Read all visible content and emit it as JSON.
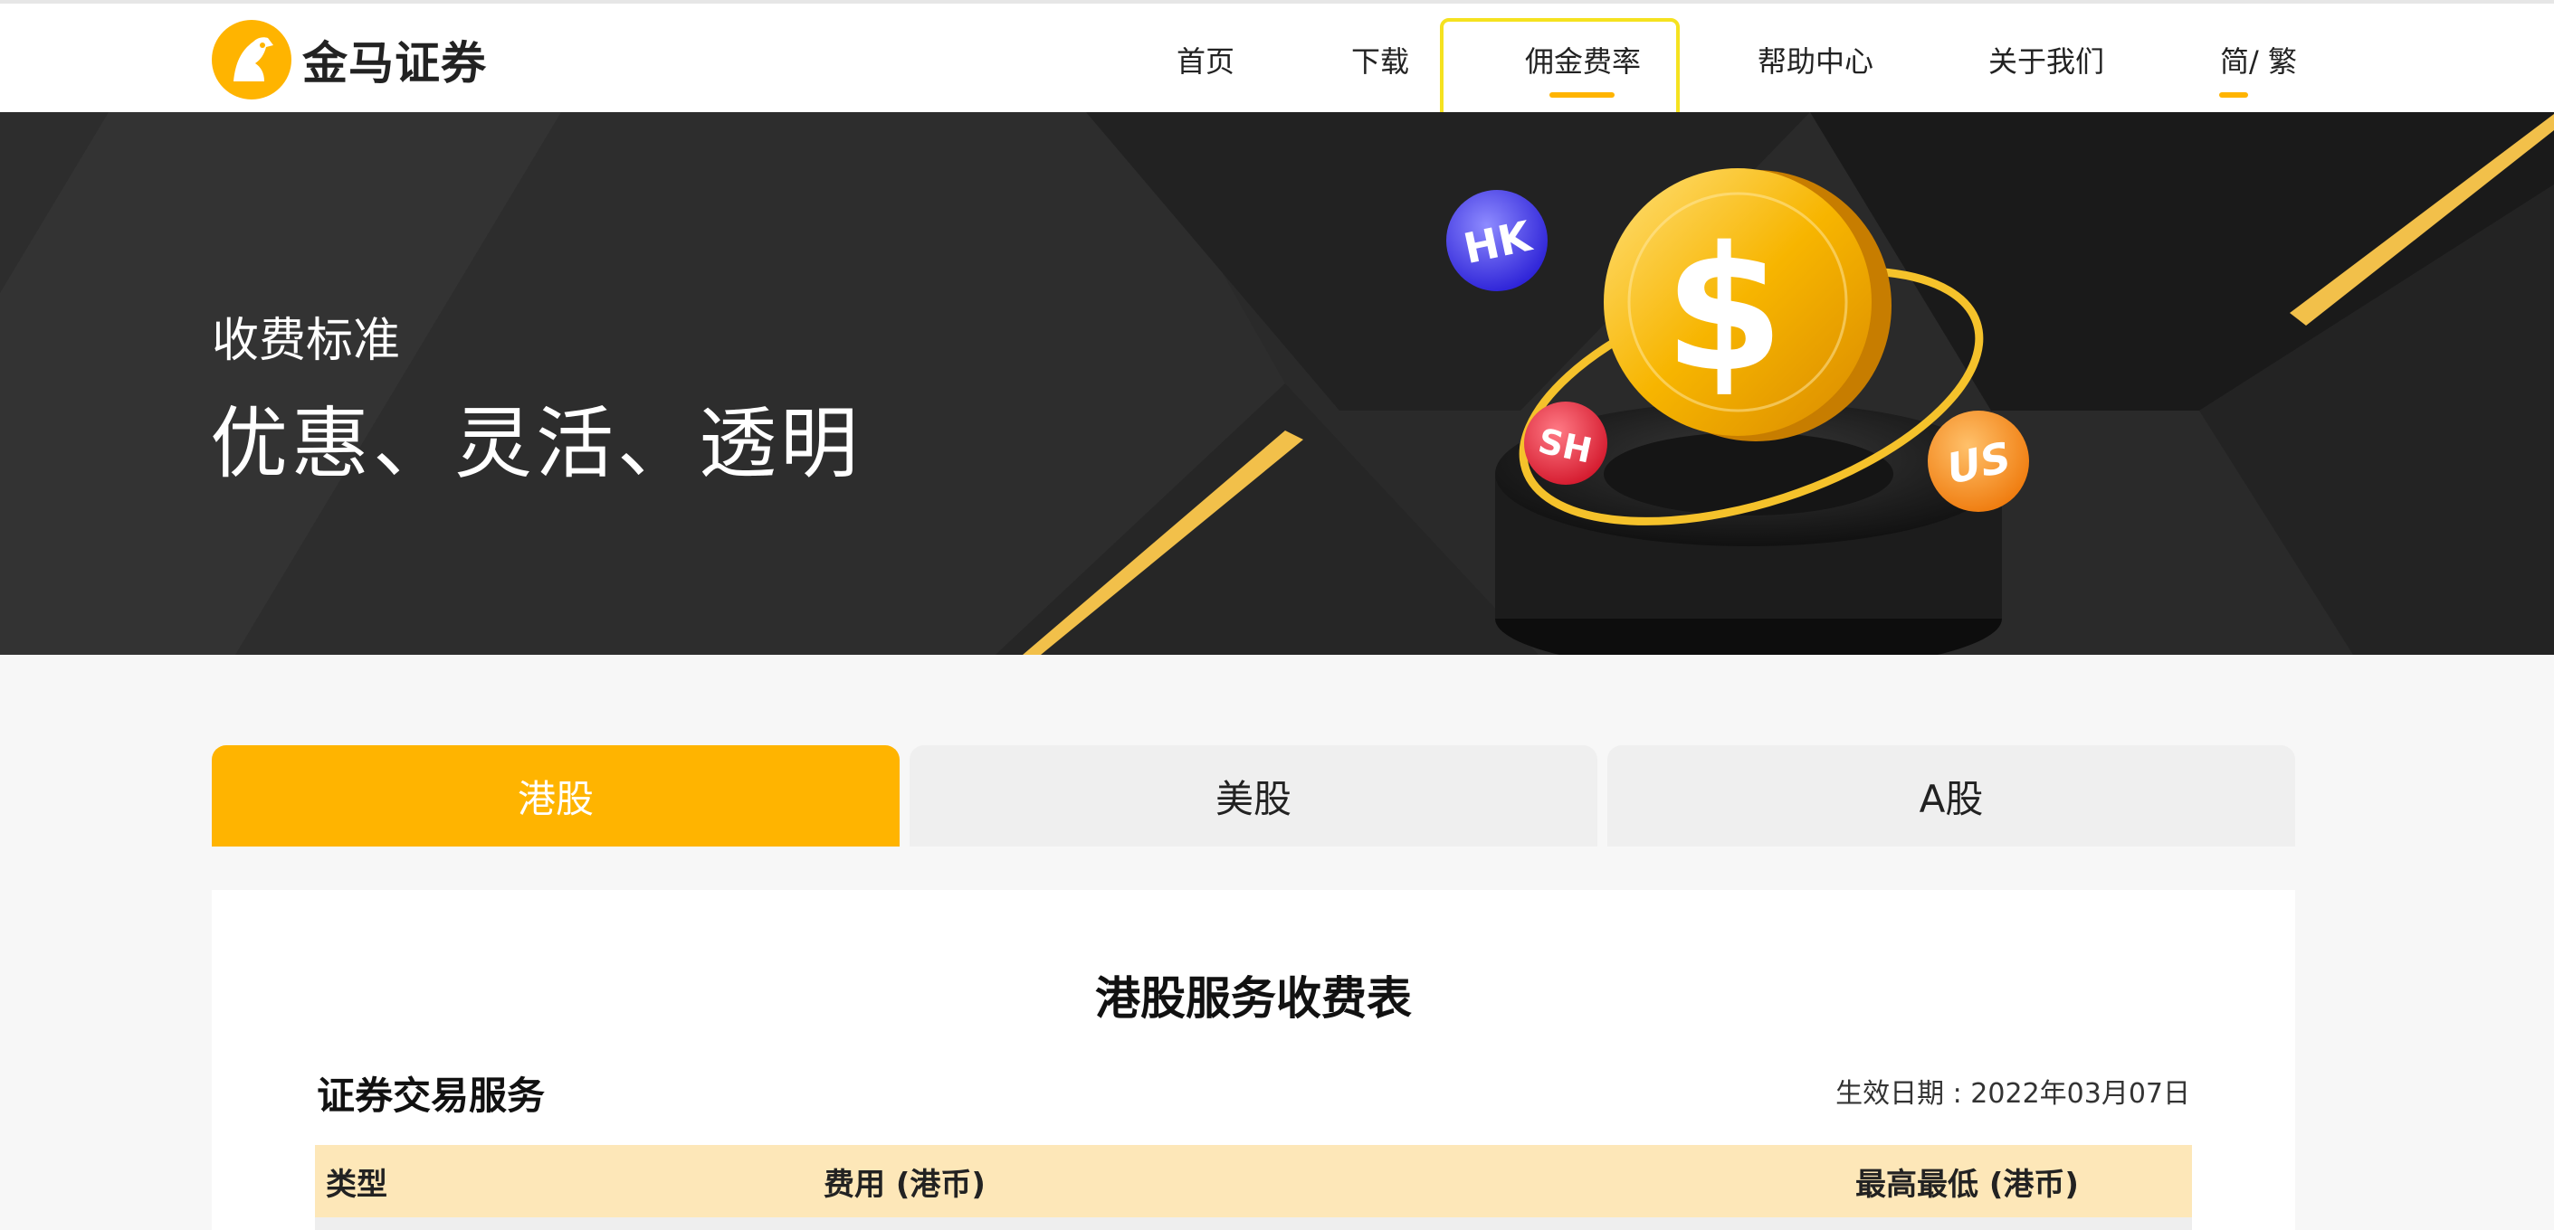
{
  "header": {
    "brand": "金马证券",
    "nav": [
      {
        "label": "首页"
      },
      {
        "label": "下载"
      },
      {
        "label": "佣金费率"
      },
      {
        "label": "帮助中心"
      },
      {
        "label": "关于我们"
      },
      {
        "label": "简/ 繁"
      }
    ],
    "accent_color": "#ffb400"
  },
  "banner": {
    "subtitle": "收费标准",
    "title": "优惠、灵活、透明",
    "coin_symbol": "$",
    "badges": [
      "HK",
      "SH",
      "US"
    ]
  },
  "tabs": [
    {
      "label": "港股",
      "active": true
    },
    {
      "label": "美股",
      "active": false
    },
    {
      "label": "A股",
      "active": false
    }
  ],
  "content": {
    "title": "港股服务收费表",
    "section_title": "证券交易服务",
    "effective_date": "生效日期 : 2022年03月07日",
    "columns": [
      "类型",
      "费用 (港币)",
      "最高最低 (港币)"
    ]
  }
}
